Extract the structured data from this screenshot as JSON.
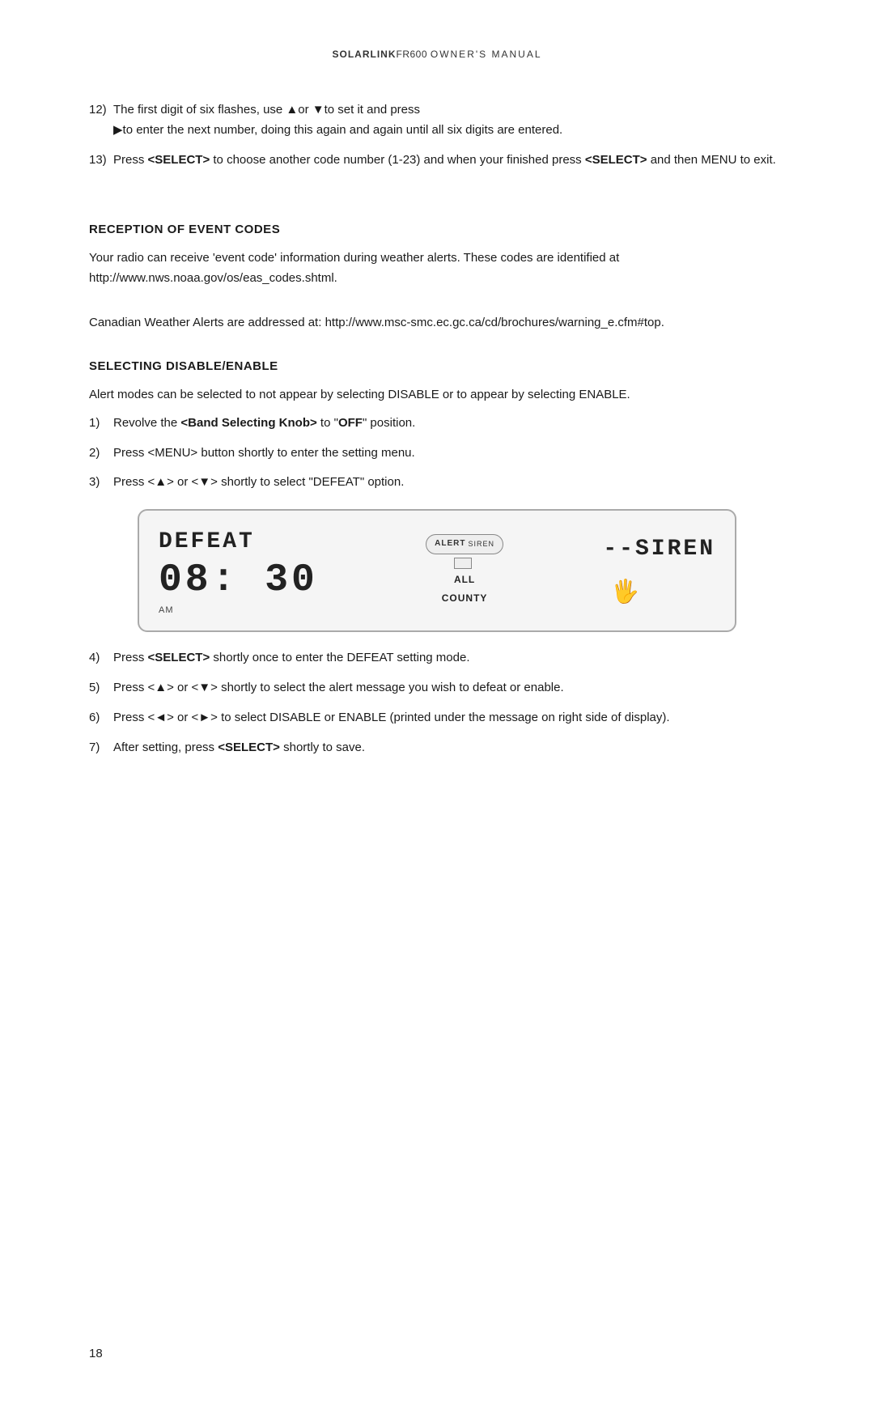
{
  "header": {
    "brand": "SOLARLINK",
    "model": "FR600",
    "doc_type": "OWNER'S MANUAL"
  },
  "page_number": "18",
  "steps_top": [
    {
      "number": "12)",
      "text": "The first digit of six flashes, use ▲or ▼to set it and press",
      "continuation": "▶to enter the next number, doing this again and again until all six digits are entered."
    },
    {
      "number": "13)",
      "text": "Press <SELECT> to choose another code number (1-23) and when your finished press <SELECT> and then MENU to exit."
    }
  ],
  "section_reception": {
    "heading": "RECEPTION OF EVENT CODES",
    "body1": "Your radio can receive 'event code' information during weather alerts. These codes are identified at http://www.nws.noaa.gov/os/eas_codes.shtml.",
    "body2": "Canadian Weather Alerts are addressed at: http://www.msc-smc.ec.gc.ca/cd/brochures/warning_e.cfm#top."
  },
  "section_disable": {
    "heading": "SELECTING DISABLE/ENABLE",
    "body": "Alert modes can be selected to not appear by selecting DISABLE or to appear by selecting ENABLE.",
    "steps": [
      {
        "number": "1)",
        "text": "Revolve the <Band Selecting Knob> to \"OFF\" position."
      },
      {
        "number": "2)",
        "text": "Press <MENU> button shortly to enter the setting menu."
      },
      {
        "number": "3)",
        "text": "Press <▲> or <▼> shortly to select \"DEFEAT\" option."
      }
    ]
  },
  "display": {
    "defeat_label": "DEFEAT",
    "siren_label": "--SIREN",
    "time": "08: 30",
    "am_label": "AM",
    "alert_label": "ALERT",
    "siren_small": "SIREN",
    "all_label": "ALL",
    "county_label": "COUNTY"
  },
  "steps_bottom": [
    {
      "number": "4)",
      "text": "Press <SELECT> shortly once to enter the DEFEAT setting mode."
    },
    {
      "number": "5)",
      "text": "Press <▲> or <▼> shortly to select the alert message you wish to defeat or enable."
    },
    {
      "number": "6)",
      "text": "Press <◄> or <►> to select DISABLE or ENABLE (printed under the message on right side of display)."
    },
    {
      "number": "7)",
      "text": "After setting, press <SELECT> shortly to save."
    }
  ]
}
